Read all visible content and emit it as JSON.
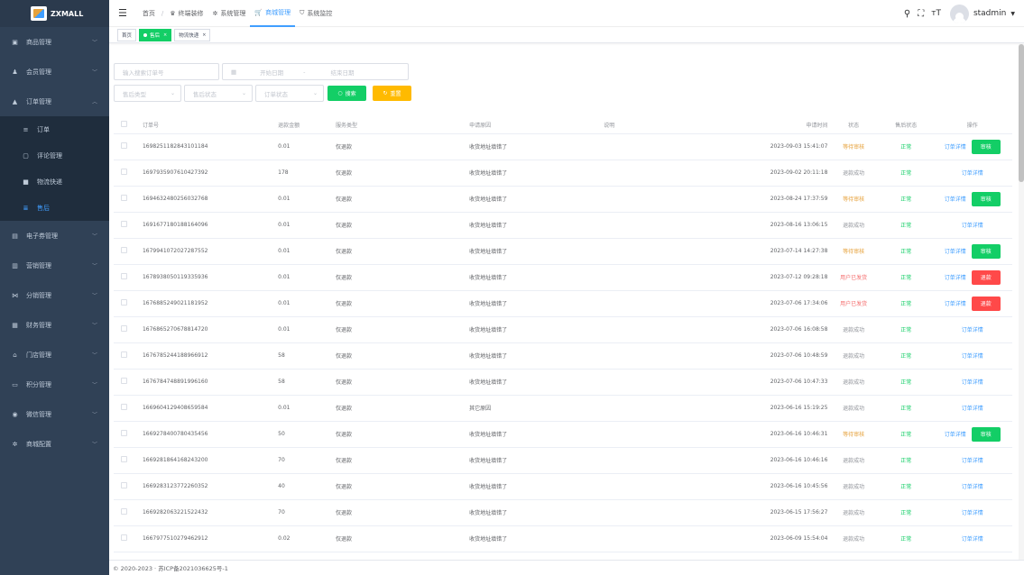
{
  "app": {
    "title": "ZXMALL"
  },
  "sidebar": {
    "items": [
      {
        "label": "商品管理",
        "icon": "goods-icon",
        "glyph": "▣"
      },
      {
        "label": "会员管理",
        "icon": "user-icon",
        "glyph": "♟"
      },
      {
        "label": "订单管理",
        "icon": "lock-icon",
        "glyph": "▲"
      }
    ],
    "sub_items": [
      {
        "label": "订单",
        "icon": "order-icon",
        "glyph": "≡"
      },
      {
        "label": "评论管理",
        "icon": "comment-icon",
        "glyph": "▢"
      },
      {
        "label": "物流快递",
        "icon": "truck-icon",
        "glyph": "■"
      },
      {
        "label": "售后",
        "icon": "aftersale-icon",
        "glyph": "≣"
      }
    ],
    "items_after": [
      {
        "label": "电子券管理",
        "icon": "coupon-icon",
        "glyph": "▤"
      },
      {
        "label": "营销管理",
        "icon": "chart-icon",
        "glyph": "▥"
      },
      {
        "label": "分销管理",
        "icon": "share-icon",
        "glyph": "⋈"
      },
      {
        "label": "财务管理",
        "icon": "finance-icon",
        "glyph": "▦"
      },
      {
        "label": "门店管理",
        "icon": "store-icon",
        "glyph": "⌂"
      },
      {
        "label": "积分管理",
        "icon": "points-icon",
        "glyph": "▭"
      },
      {
        "label": "微信管理",
        "icon": "wechat-icon",
        "glyph": "◉"
      },
      {
        "label": "商城配置",
        "icon": "gear-icon",
        "glyph": "✲"
      }
    ]
  },
  "header": {
    "breadcrumb_home": "首页",
    "nav": [
      {
        "label": "终端装修",
        "glyph": "♛",
        "icon": "decorate-icon"
      },
      {
        "label": "系统管理",
        "glyph": "✲",
        "icon": "settings-icon"
      },
      {
        "label": "商城管理",
        "glyph": "🛒",
        "icon": "cart-icon"
      },
      {
        "label": "系统监控",
        "glyph": "⛉",
        "icon": "monitor-icon"
      }
    ],
    "user": "stadmin"
  },
  "tags": [
    {
      "label": "首页"
    },
    {
      "label": "售后"
    },
    {
      "label": "物流快递"
    }
  ],
  "filters": {
    "order_placeholder": "输入搜索订单号",
    "start_date": "开始日期",
    "date_sep": "-",
    "end_date": "结束日期",
    "aftersale_type": "售后类型",
    "aftersale_status": "售后状态",
    "order_status": "订单状态",
    "search_label": "搜索",
    "reset_label": "重置"
  },
  "colors": {
    "primary": "#409eff",
    "success": "#13ce66",
    "warning": "#ffba00",
    "danger": "#ff4949",
    "orange": "#e6a23c",
    "red": "#f56c6c",
    "sidebar": "#304156"
  },
  "table": {
    "headers": [
      "订单号",
      "退款金额",
      "服务类型",
      "申请原因",
      "说明",
      "申请时间",
      "状态",
      "售后状态",
      "操作"
    ],
    "rows": [
      {
        "order_no": "1698251182843101184",
        "amount": "0.01",
        "service": "仅退款",
        "reason": "收货地址填错了",
        "note": "",
        "time": "2023-09-03 15:41:07",
        "status": "等待审核",
        "status_color": "#e6a23c",
        "after": "正常",
        "detail": "订单详情",
        "action": "审核",
        "action_color": "#13ce66"
      },
      {
        "order_no": "1697935907610427392",
        "amount": "178",
        "service": "仅退款",
        "reason": "收货地址填错了",
        "note": "",
        "time": "2023-09-02 20:11:18",
        "status": "退款成功",
        "status_color": "#909399",
        "after": "正常",
        "detail": "订单详情",
        "action": "",
        "action_color": ""
      },
      {
        "order_no": "1694632480256032768",
        "amount": "0.01",
        "service": "仅退款",
        "reason": "收货地址填错了",
        "note": "",
        "time": "2023-08-24 17:37:59",
        "status": "等待审核",
        "status_color": "#e6a23c",
        "after": "正常",
        "detail": "订单详情",
        "action": "审核",
        "action_color": "#13ce66"
      },
      {
        "order_no": "1691677180188164096",
        "amount": "0.01",
        "service": "仅退款",
        "reason": "收货地址填错了",
        "note": "",
        "time": "2023-08-16 13:06:15",
        "status": "退款成功",
        "status_color": "#909399",
        "after": "正常",
        "detail": "订单详情",
        "action": "",
        "action_color": ""
      },
      {
        "order_no": "1679941072027287552",
        "amount": "0.01",
        "service": "仅退款",
        "reason": "收货地址填错了",
        "note": "",
        "time": "2023-07-14 14:27:38",
        "status": "等待审核",
        "status_color": "#e6a23c",
        "after": "正常",
        "detail": "订单详情",
        "action": "审核",
        "action_color": "#13ce66"
      },
      {
        "order_no": "1678938050119335936",
        "amount": "0.01",
        "service": "仅退款",
        "reason": "收货地址填错了",
        "note": "",
        "time": "2023-07-12 09:28:18",
        "status": "用户已发货",
        "status_color": "#f56c6c",
        "after": "正常",
        "detail": "订单详情",
        "action": "退款",
        "action_color": "#ff4949"
      },
      {
        "order_no": "1676885249021181952",
        "amount": "0.01",
        "service": "仅退款",
        "reason": "收货地址填错了",
        "note": "",
        "time": "2023-07-06 17:34:06",
        "status": "用户已发货",
        "status_color": "#f56c6c",
        "after": "正常",
        "detail": "订单详情",
        "action": "退款",
        "action_color": "#ff4949"
      },
      {
        "order_no": "1676865270678814720",
        "amount": "0.01",
        "service": "仅退款",
        "reason": "收货地址填错了",
        "note": "",
        "time": "2023-07-06 16:08:58",
        "status": "退款成功",
        "status_color": "#909399",
        "after": "正常",
        "detail": "订单详情",
        "action": "",
        "action_color": ""
      },
      {
        "order_no": "1676785244188966912",
        "amount": "58",
        "service": "仅退款",
        "reason": "收货地址填错了",
        "note": "",
        "time": "2023-07-06 10:48:59",
        "status": "退款成功",
        "status_color": "#909399",
        "after": "正常",
        "detail": "订单详情",
        "action": "",
        "action_color": ""
      },
      {
        "order_no": "1676784748891996160",
        "amount": "58",
        "service": "仅退款",
        "reason": "收货地址填错了",
        "note": "",
        "time": "2023-07-06 10:47:33",
        "status": "退款成功",
        "status_color": "#909399",
        "after": "正常",
        "detail": "订单详情",
        "action": "",
        "action_color": ""
      },
      {
        "order_no": "1669604129408659584",
        "amount": "0.01",
        "service": "仅退款",
        "reason": "其它原因",
        "note": "",
        "time": "2023-06-16 15:19:25",
        "status": "退款成功",
        "status_color": "#909399",
        "after": "正常",
        "detail": "订单详情",
        "action": "",
        "action_color": ""
      },
      {
        "order_no": "1669278400780435456",
        "amount": "50",
        "service": "仅退款",
        "reason": "收货地址填错了",
        "note": "",
        "time": "2023-06-16 10:46:31",
        "status": "等待审核",
        "status_color": "#e6a23c",
        "after": "正常",
        "detail": "订单详情",
        "action": "审核",
        "action_color": "#13ce66"
      },
      {
        "order_no": "1669281864168243200",
        "amount": "70",
        "service": "仅退款",
        "reason": "收货地址填错了",
        "note": "",
        "time": "2023-06-16 10:46:16",
        "status": "退款成功",
        "status_color": "#909399",
        "after": "正常",
        "detail": "订单详情",
        "action": "",
        "action_color": ""
      },
      {
        "order_no": "1669283123772260352",
        "amount": "40",
        "service": "仅退款",
        "reason": "收货地址填错了",
        "note": "",
        "time": "2023-06-16 10:45:56",
        "status": "退款成功",
        "status_color": "#909399",
        "after": "正常",
        "detail": "订单详情",
        "action": "",
        "action_color": ""
      },
      {
        "order_no": "1669282063221522432",
        "amount": "70",
        "service": "仅退款",
        "reason": "收货地址填错了",
        "note": "",
        "time": "2023-06-15 17:56:27",
        "status": "退款成功",
        "status_color": "#909399",
        "after": "正常",
        "detail": "订单详情",
        "action": "",
        "action_color": ""
      },
      {
        "order_no": "1667977510279462912",
        "amount": "0.02",
        "service": "仅退款",
        "reason": "收货地址填错了",
        "note": "",
        "time": "2023-06-09 15:54:04",
        "status": "退款成功",
        "status_color": "#909399",
        "after": "正常",
        "detail": "订单详情",
        "action": "",
        "action_color": ""
      }
    ]
  },
  "footer": {
    "text": "© 2020-2023 · 苏ICP备2021036625号-1"
  }
}
